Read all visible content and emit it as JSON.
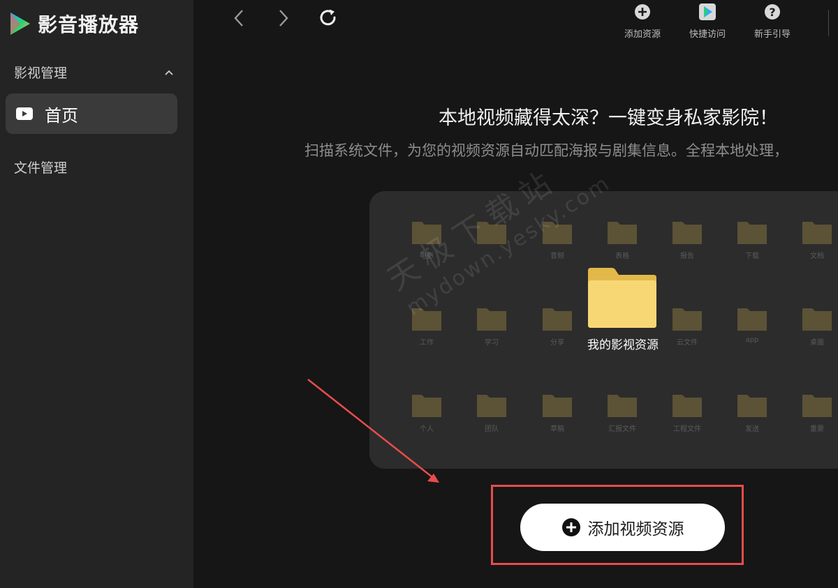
{
  "app": {
    "name": "影音播放器"
  },
  "sidebar": {
    "section_label": "影视管理",
    "active_item": {
      "label": "首页"
    },
    "second_section_label": "文件管理"
  },
  "toolbar": {
    "add_resource": "添加资源",
    "quick_access": "快捷访问",
    "beginner_guide": "新手引导"
  },
  "hero": {
    "title": "本地视频藏得太深？一键变身私家影院！",
    "subtitle": "扫描系统文件，为您的视频资源自动匹配海报与剧集信息。全程本地处理，"
  },
  "folders": {
    "main_label": "我的影视资源",
    "row1": [
      "电影",
      "",
      "音频",
      "表格",
      "报告",
      "下载",
      "文档"
    ],
    "row2": [
      "工作",
      "学习",
      "分享",
      "",
      "云文件",
      "app",
      "桌面"
    ],
    "row3": [
      "个人",
      "团队",
      "草稿",
      "汇报文件",
      "工程文件",
      "发送",
      "重要"
    ]
  },
  "watermark": {
    "line1": "天极下载站",
    "line2": "mydown.yesky.com"
  },
  "cta": {
    "label": "添加视频资源"
  },
  "colors": {
    "highlight": "#e94c4c",
    "folder": "#f7d774",
    "sidebar": "#242424",
    "background": "#161616"
  }
}
